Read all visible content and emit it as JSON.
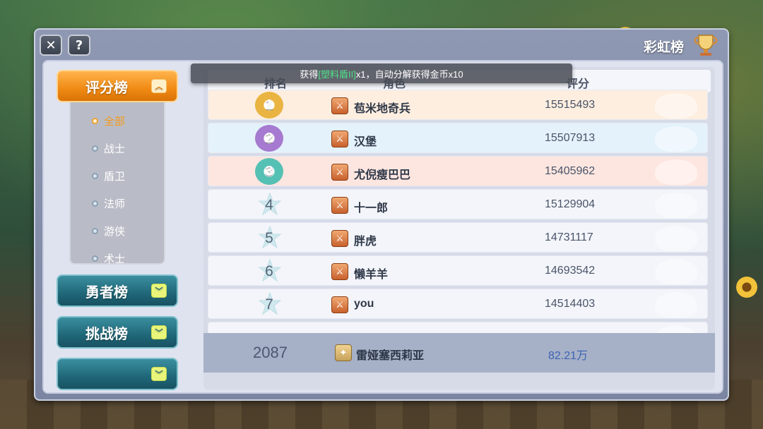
{
  "window": {
    "title": "彩虹榜",
    "close_glyph": "✕",
    "help_glyph": "?"
  },
  "toast": {
    "prefix": "获得",
    "item": "[塑料盾II]",
    "suffix": "x1，自动分解获得金币x10"
  },
  "sidebar": {
    "categories": [
      {
        "label": "评分榜",
        "state": "expanded"
      },
      {
        "label": "勇者榜",
        "state": "collapsed"
      },
      {
        "label": "挑战榜",
        "state": "collapsed"
      },
      {
        "label": "",
        "state": "collapsed"
      }
    ],
    "sub_items": [
      "全部",
      "战士",
      "盾卫",
      "法师",
      "游侠",
      "术士"
    ],
    "selected_sub_item": "全部"
  },
  "table": {
    "headers": {
      "rank": "排名",
      "role": "角色",
      "score": "评分"
    },
    "rows": [
      {
        "rank": "1",
        "name": "苞米地奇兵",
        "score": "15515493",
        "bg": "#fdeee0",
        "medal": "#e9b441"
      },
      {
        "rank": "2",
        "name": "汉堡",
        "score": "15507913",
        "bg": "#e4f2fb",
        "medal": "#a67ad0"
      },
      {
        "rank": "3",
        "name": "尤倪瘦巴巴",
        "score": "15405962",
        "bg": "#fde6e0",
        "medal": "#55c0b4"
      },
      {
        "rank": "4",
        "name": "十一郎",
        "score": "15129904",
        "bg": "#f3f5fa",
        "medal": ""
      },
      {
        "rank": "5",
        "name": "胖虎",
        "score": "14731117",
        "bg": "#f3f5fa",
        "medal": ""
      },
      {
        "rank": "6",
        "name": "懒羊羊",
        "score": "14693542",
        "bg": "#f3f5fa",
        "medal": ""
      },
      {
        "rank": "7",
        "name": "you",
        "score": "14514403",
        "bg": "#f3f5fa",
        "medal": ""
      },
      {
        "rank": "",
        "name": "",
        "score": "",
        "bg": "#f3f5fa",
        "medal": ""
      }
    ],
    "self": {
      "rank": "2087",
      "name": "雷娅塞西莉亚",
      "score": "82.21万"
    }
  },
  "colors": {
    "accent_orange": "#f08a14",
    "accent_teal": "#1f6778",
    "score_self": "#3c63b6"
  }
}
